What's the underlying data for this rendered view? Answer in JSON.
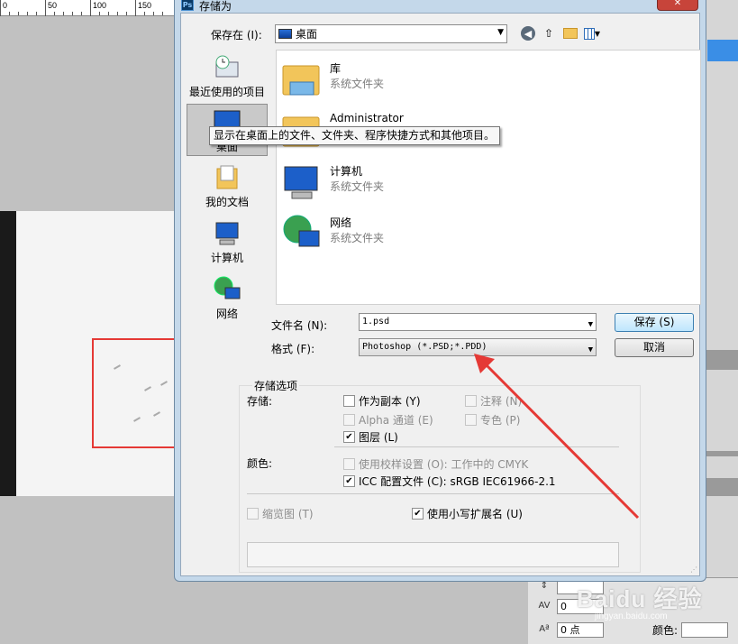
{
  "ruler": {
    "ticks": [
      "0",
      "50",
      "100",
      "150"
    ]
  },
  "dialog": {
    "title": "存储为",
    "app_icon": "Ps",
    "close_label": "✕",
    "save_in_label": "保存在 (I):",
    "save_in_value": "桌面",
    "places": [
      {
        "label": "最近使用的项目",
        "icon": "recent-icon"
      },
      {
        "label": "桌面",
        "icon": "desktop-icon"
      },
      {
        "label": "我的文档",
        "icon": "documents-icon"
      },
      {
        "label": "计算机",
        "icon": "computer-icon"
      },
      {
        "label": "网络",
        "icon": "network-icon"
      }
    ],
    "files": [
      {
        "name": "库",
        "type": "系统文件夹",
        "icon": "library-folder-icon"
      },
      {
        "name": "Administrator",
        "type": "",
        "icon": "user-folder-icon"
      },
      {
        "name": "计算机",
        "type": "系统文件夹",
        "icon": "computer-icon"
      },
      {
        "name": "网络",
        "type": "系统文件夹",
        "icon": "network-icon"
      }
    ],
    "tooltip": "显示在桌面上的文件、文件夹、程序快捷方式和其他项目。",
    "filename_label": "文件名 (N):",
    "filename_value": "1.psd",
    "format_label": "格式 (F):",
    "format_value": "Photoshop (*.PSD;*.PDD)",
    "save_button": "保存 (S)",
    "cancel_button": "取消",
    "options": {
      "title": "存储选项",
      "storage_label": "存储:",
      "as_copy": "作为副本 (Y)",
      "notes": "注释 (N)",
      "alpha": "Alpha 通道 (E)",
      "spot": "专色 (P)",
      "layers": "图层 (L)",
      "color_label": "颜色:",
      "proof": "使用校样设置 (O):  工作中的 CMYK",
      "icc": "ICC 配置文件 (C):  sRGB IEC61966-2.1",
      "thumbnail": "缩览图 (T)",
      "lowercase_ext": "使用小写扩展名 (U)"
    }
  },
  "char_panel": {
    "tracking_value": "0",
    "kerning_value": "0",
    "baseline_value": "0 点",
    "color_label": "颜色:"
  },
  "watermark": {
    "text": "Baidu 经验",
    "sub": "jingyan.baidu.com"
  },
  "colors": {
    "annotation_red": "#e53935",
    "dialog_frame": "#c4d8ea"
  }
}
